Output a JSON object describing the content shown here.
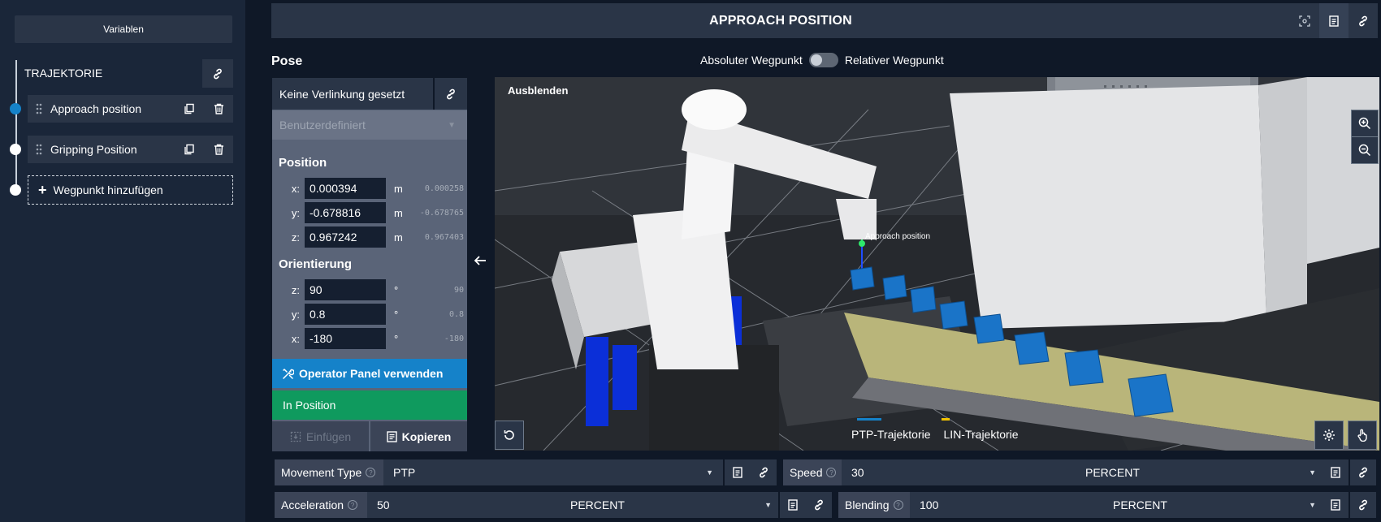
{
  "sidebar": {
    "variables_label": "Variablen",
    "trajectory_title": "TRAJEKTORIE",
    "waypoints": [
      {
        "label": "Approach position",
        "active": true
      },
      {
        "label": "Gripping Position",
        "active": false
      }
    ],
    "add_waypoint_label": "Wegpunkt hinzufügen"
  },
  "header": {
    "title": "APPROACH POSITION"
  },
  "pose": {
    "title": "Pose",
    "toggle_left": "Absoluter Wegpunkt",
    "toggle_right": "Relativer Wegpunkt",
    "link_label": "Keine Verlinkung gesetzt",
    "frame_select": "Benutzerdefiniert",
    "position": {
      "title": "Position",
      "rows": [
        {
          "axis": "x:",
          "value": "0.000394",
          "unit": "m",
          "ref": "0.000258"
        },
        {
          "axis": "y:",
          "value": "-0.678816",
          "unit": "m",
          "ref": "-0.678765"
        },
        {
          "axis": "z:",
          "value": "0.967242",
          "unit": "m",
          "ref": "0.967403"
        }
      ]
    },
    "orientation": {
      "title": "Orientierung",
      "rows": [
        {
          "axis": "z:",
          "value": "90",
          "unit": "°",
          "ref": "90"
        },
        {
          "axis": "y:",
          "value": "0.8",
          "unit": "°",
          "ref": "0.8"
        },
        {
          "axis": "x:",
          "value": "-180",
          "unit": "°",
          "ref": "-180"
        }
      ]
    },
    "operator_panel_label": "Operator Panel verwenden",
    "in_position_label": "In Position",
    "paste_label": "Einfügen",
    "copy_label": "Kopieren"
  },
  "viewport": {
    "hide_label": "Ausblenden",
    "marker_label": "Approach position",
    "legend": [
      {
        "label": "PTP-Trajektorie",
        "color": "#1582c9"
      },
      {
        "label": "LIN-Trajektorie",
        "color": "#f2c200"
      }
    ]
  },
  "params": {
    "movement_type": {
      "label": "Movement Type",
      "value": "PTP"
    },
    "speed": {
      "label": "Speed",
      "value": "30",
      "unit": "PERCENT"
    },
    "acceleration": {
      "label": "Acceleration",
      "value": "50",
      "unit": "PERCENT"
    },
    "blending": {
      "label": "Blending",
      "value": "100",
      "unit": "PERCENT"
    }
  },
  "colors": {
    "accent": "#1582c9",
    "success": "#0f9a5e",
    "panel": "#2a3547",
    "background": "#0f1827"
  }
}
